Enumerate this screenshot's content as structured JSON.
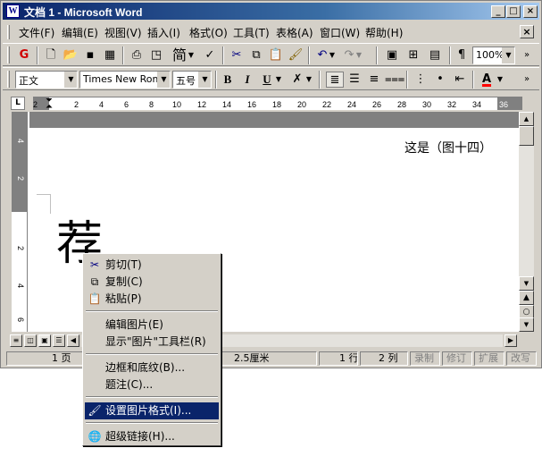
{
  "window": {
    "title": "文档 1 - Microsoft Word",
    "app_icon": "W"
  },
  "title_buttons": {
    "minimize": "_",
    "maximize": "□",
    "close": "×"
  },
  "menubar": {
    "items": [
      "文件(F)",
      "编辑(E)",
      "视图(V)",
      "插入(I)",
      "格式(O)",
      "工具(T)",
      "表格(A)",
      "窗口(W)",
      "帮助(H)"
    ],
    "doc_close": "×"
  },
  "standard_toolbar": {
    "icons": [
      "new-icon",
      "open-icon",
      "save-icon",
      "permission-icon",
      "print-icon",
      "print-preview-icon",
      "spelling-icon",
      "cut-icon",
      "copy-icon",
      "paste-icon",
      "format-painter-icon",
      "undo-icon",
      "redo-icon"
    ],
    "simplified_label": "简",
    "zoom": "100%"
  },
  "formatting_toolbar": {
    "style": "正文",
    "font": "Times New Roman",
    "size": "五号",
    "bold": "B",
    "italic": "I",
    "underline": "U",
    "font_color_label": "A",
    "font_color": "#ff0000"
  },
  "ruler": {
    "ticks": [
      "2",
      "2",
      "4",
      "6",
      "8",
      "10",
      "12",
      "14",
      "16",
      "18",
      "20",
      "22",
      "24",
      "26",
      "28",
      "30",
      "32",
      "34",
      "36"
    ]
  },
  "vertical_ruler": {
    "ticks": [
      "4",
      "2",
      "2",
      "4",
      "6"
    ]
  },
  "document": {
    "text": "这是（图十四）",
    "big_char": "荐"
  },
  "statusbar": {
    "page": "1 页",
    "position": "2.5厘米",
    "line": "1 行",
    "column": "2 列",
    "rec": "录制",
    "trk": "修订",
    "ext": "扩展",
    "ovr": "改写"
  },
  "context_menu": {
    "items": [
      {
        "label": "剪切(T)",
        "icon": "scissors-icon"
      },
      {
        "label": "复制(C)",
        "icon": "copy-icon"
      },
      {
        "label": "粘贴(P)",
        "icon": "paste-icon"
      },
      {
        "label": "编辑图片(E)",
        "icon": ""
      },
      {
        "label": "显示\"图片\"工具栏(R)",
        "icon": ""
      },
      {
        "label": "边框和底纹(B)...",
        "icon": ""
      },
      {
        "label": "题注(C)...",
        "icon": ""
      },
      {
        "label": "设置图片格式(I)...",
        "icon": "format-picture-icon",
        "selected": true
      },
      {
        "label": "超级链接(H)...",
        "icon": "hyperlink-icon"
      }
    ]
  },
  "colors": {
    "title_start": "#0a246a",
    "title_end": "#a6caf0",
    "selection": "#0a246a",
    "face": "#d4d0c8"
  }
}
